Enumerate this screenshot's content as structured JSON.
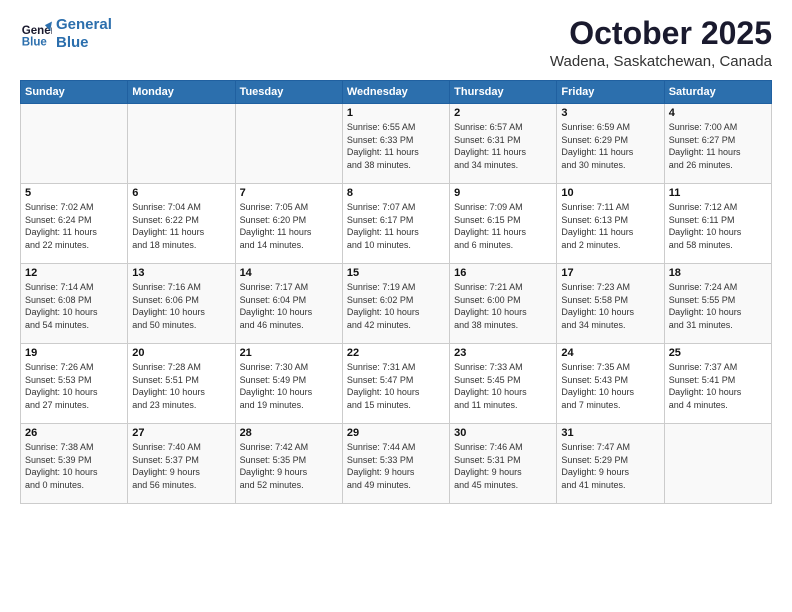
{
  "header": {
    "logo_line1": "General",
    "logo_line2": "Blue",
    "title": "October 2025",
    "subtitle": "Wadena, Saskatchewan, Canada"
  },
  "weekdays": [
    "Sunday",
    "Monday",
    "Tuesday",
    "Wednesday",
    "Thursday",
    "Friday",
    "Saturday"
  ],
  "weeks": [
    [
      {
        "day": "",
        "info": ""
      },
      {
        "day": "",
        "info": ""
      },
      {
        "day": "",
        "info": ""
      },
      {
        "day": "1",
        "info": "Sunrise: 6:55 AM\nSunset: 6:33 PM\nDaylight: 11 hours\nand 38 minutes."
      },
      {
        "day": "2",
        "info": "Sunrise: 6:57 AM\nSunset: 6:31 PM\nDaylight: 11 hours\nand 34 minutes."
      },
      {
        "day": "3",
        "info": "Sunrise: 6:59 AM\nSunset: 6:29 PM\nDaylight: 11 hours\nand 30 minutes."
      },
      {
        "day": "4",
        "info": "Sunrise: 7:00 AM\nSunset: 6:27 PM\nDaylight: 11 hours\nand 26 minutes."
      }
    ],
    [
      {
        "day": "5",
        "info": "Sunrise: 7:02 AM\nSunset: 6:24 PM\nDaylight: 11 hours\nand 22 minutes."
      },
      {
        "day": "6",
        "info": "Sunrise: 7:04 AM\nSunset: 6:22 PM\nDaylight: 11 hours\nand 18 minutes."
      },
      {
        "day": "7",
        "info": "Sunrise: 7:05 AM\nSunset: 6:20 PM\nDaylight: 11 hours\nand 14 minutes."
      },
      {
        "day": "8",
        "info": "Sunrise: 7:07 AM\nSunset: 6:17 PM\nDaylight: 11 hours\nand 10 minutes."
      },
      {
        "day": "9",
        "info": "Sunrise: 7:09 AM\nSunset: 6:15 PM\nDaylight: 11 hours\nand 6 minutes."
      },
      {
        "day": "10",
        "info": "Sunrise: 7:11 AM\nSunset: 6:13 PM\nDaylight: 11 hours\nand 2 minutes."
      },
      {
        "day": "11",
        "info": "Sunrise: 7:12 AM\nSunset: 6:11 PM\nDaylight: 10 hours\nand 58 minutes."
      }
    ],
    [
      {
        "day": "12",
        "info": "Sunrise: 7:14 AM\nSunset: 6:08 PM\nDaylight: 10 hours\nand 54 minutes."
      },
      {
        "day": "13",
        "info": "Sunrise: 7:16 AM\nSunset: 6:06 PM\nDaylight: 10 hours\nand 50 minutes."
      },
      {
        "day": "14",
        "info": "Sunrise: 7:17 AM\nSunset: 6:04 PM\nDaylight: 10 hours\nand 46 minutes."
      },
      {
        "day": "15",
        "info": "Sunrise: 7:19 AM\nSunset: 6:02 PM\nDaylight: 10 hours\nand 42 minutes."
      },
      {
        "day": "16",
        "info": "Sunrise: 7:21 AM\nSunset: 6:00 PM\nDaylight: 10 hours\nand 38 minutes."
      },
      {
        "day": "17",
        "info": "Sunrise: 7:23 AM\nSunset: 5:58 PM\nDaylight: 10 hours\nand 34 minutes."
      },
      {
        "day": "18",
        "info": "Sunrise: 7:24 AM\nSunset: 5:55 PM\nDaylight: 10 hours\nand 31 minutes."
      }
    ],
    [
      {
        "day": "19",
        "info": "Sunrise: 7:26 AM\nSunset: 5:53 PM\nDaylight: 10 hours\nand 27 minutes."
      },
      {
        "day": "20",
        "info": "Sunrise: 7:28 AM\nSunset: 5:51 PM\nDaylight: 10 hours\nand 23 minutes."
      },
      {
        "day": "21",
        "info": "Sunrise: 7:30 AM\nSunset: 5:49 PM\nDaylight: 10 hours\nand 19 minutes."
      },
      {
        "day": "22",
        "info": "Sunrise: 7:31 AM\nSunset: 5:47 PM\nDaylight: 10 hours\nand 15 minutes."
      },
      {
        "day": "23",
        "info": "Sunrise: 7:33 AM\nSunset: 5:45 PM\nDaylight: 10 hours\nand 11 minutes."
      },
      {
        "day": "24",
        "info": "Sunrise: 7:35 AM\nSunset: 5:43 PM\nDaylight: 10 hours\nand 7 minutes."
      },
      {
        "day": "25",
        "info": "Sunrise: 7:37 AM\nSunset: 5:41 PM\nDaylight: 10 hours\nand 4 minutes."
      }
    ],
    [
      {
        "day": "26",
        "info": "Sunrise: 7:38 AM\nSunset: 5:39 PM\nDaylight: 10 hours\nand 0 minutes."
      },
      {
        "day": "27",
        "info": "Sunrise: 7:40 AM\nSunset: 5:37 PM\nDaylight: 9 hours\nand 56 minutes."
      },
      {
        "day": "28",
        "info": "Sunrise: 7:42 AM\nSunset: 5:35 PM\nDaylight: 9 hours\nand 52 minutes."
      },
      {
        "day": "29",
        "info": "Sunrise: 7:44 AM\nSunset: 5:33 PM\nDaylight: 9 hours\nand 49 minutes."
      },
      {
        "day": "30",
        "info": "Sunrise: 7:46 AM\nSunset: 5:31 PM\nDaylight: 9 hours\nand 45 minutes."
      },
      {
        "day": "31",
        "info": "Sunrise: 7:47 AM\nSunset: 5:29 PM\nDaylight: 9 hours\nand 41 minutes."
      },
      {
        "day": "",
        "info": ""
      }
    ]
  ]
}
